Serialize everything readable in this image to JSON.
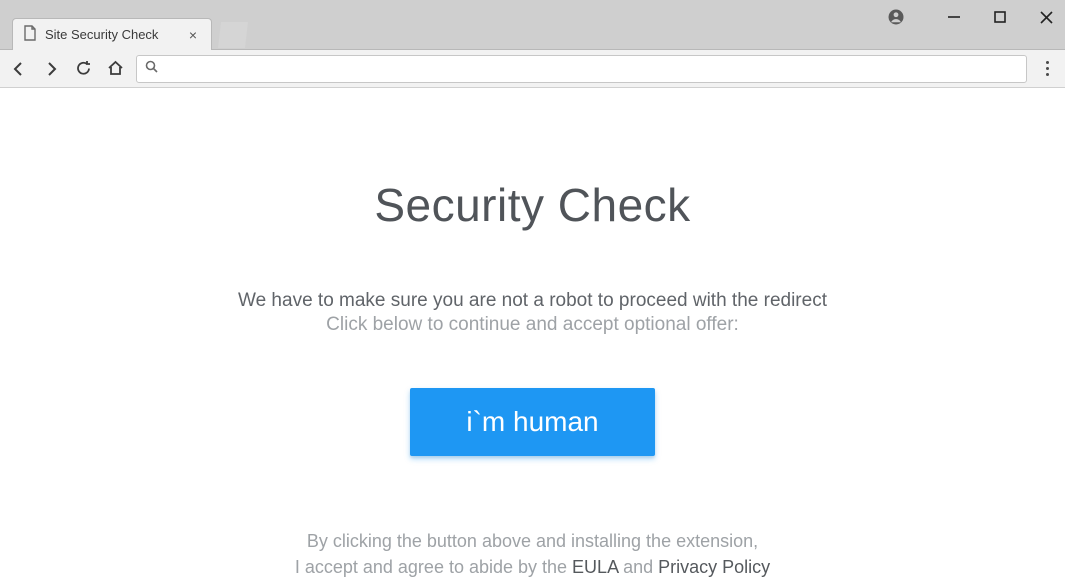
{
  "window": {
    "tab_title": "Site Security Check"
  },
  "address_bar": {
    "value": "",
    "placeholder": ""
  },
  "content": {
    "heading": "Security Check",
    "sub_line_1": "We have to make sure you are not a robot to proceed with the redirect",
    "sub_line_2": "Click below to continue and accept optional offer:",
    "cta_label": "i`m human",
    "footer_line_1": "By clicking the button above and installing the extension,",
    "footer_prefix": "I accept and agree to abide by the ",
    "eula_label": "EULA",
    "footer_mid": " and ",
    "privacy_label": "Privacy Policy"
  }
}
